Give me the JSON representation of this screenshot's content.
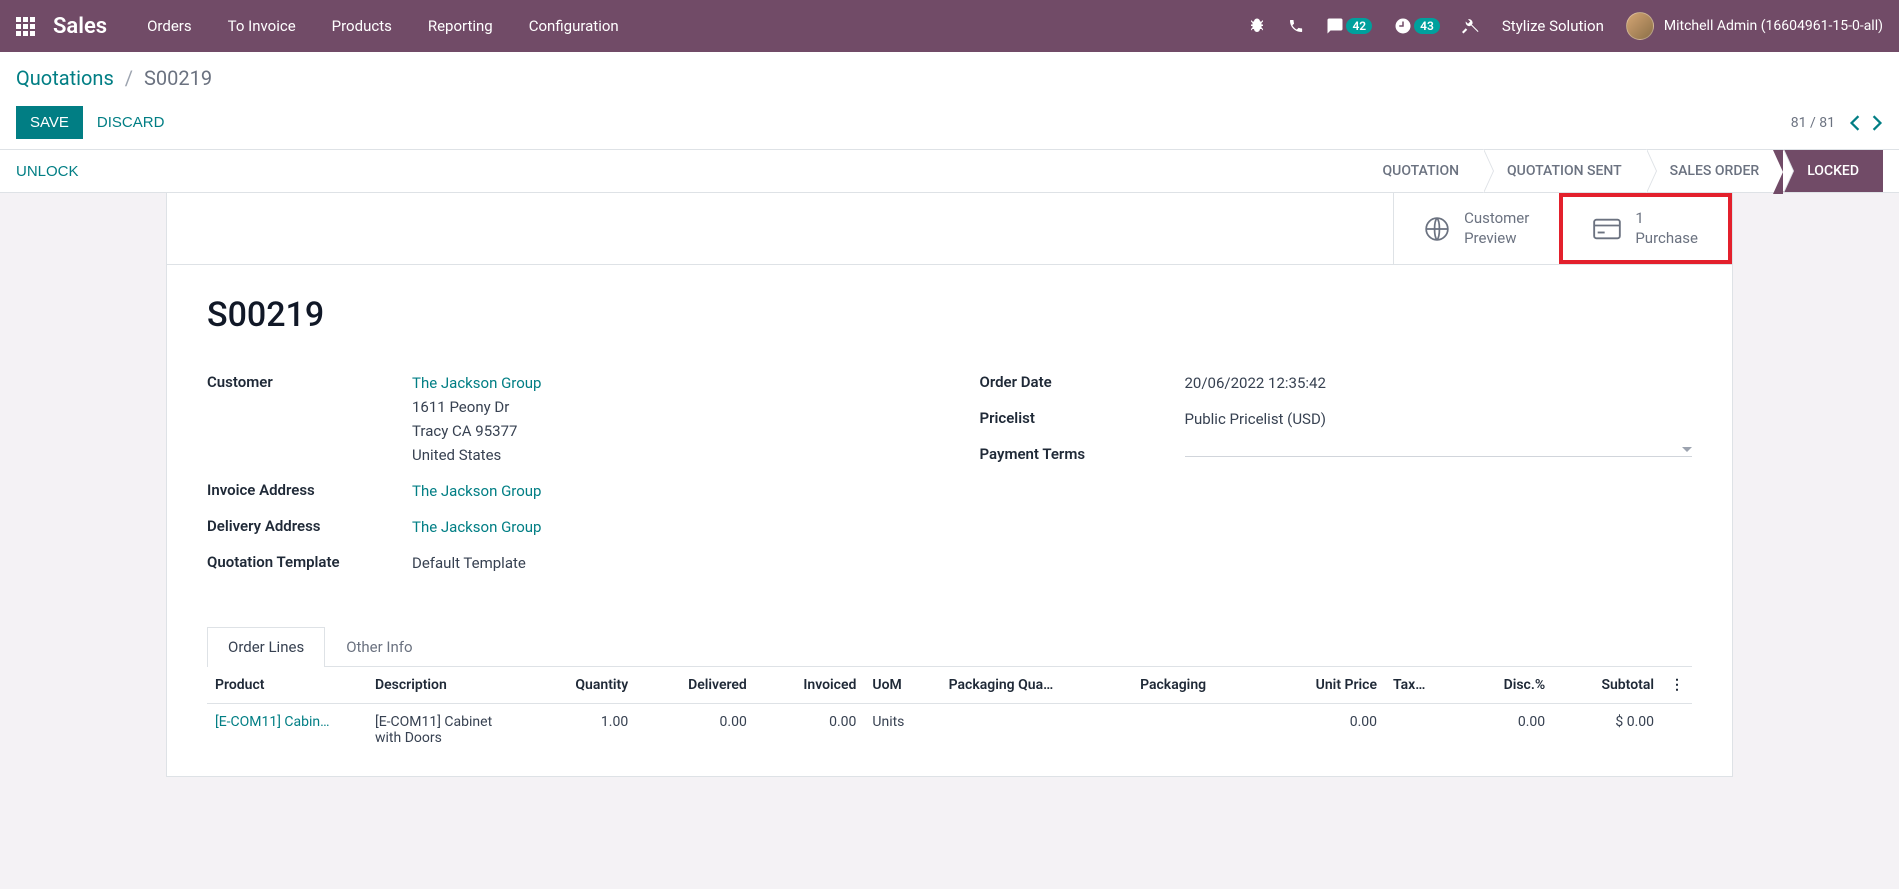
{
  "topnav": {
    "brand": "Sales",
    "menu": [
      "Orders",
      "To Invoice",
      "Products",
      "Reporting",
      "Configuration"
    ],
    "badges": {
      "messages": "42",
      "activities": "43"
    },
    "company": "Stylize Solution",
    "user": "Mitchell Admin (16604961-15-0-all)"
  },
  "breadcrumb": {
    "root": "Quotations",
    "current": "S00219"
  },
  "actions": {
    "save": "SAVE",
    "discard": "DISCARD",
    "unlock": "UNLOCK"
  },
  "pager": {
    "text": "81 / 81"
  },
  "status": {
    "steps": [
      "QUOTATION",
      "QUOTATION SENT",
      "SALES ORDER",
      "LOCKED"
    ],
    "active": 3
  },
  "stat_buttons": {
    "preview": {
      "line1": "Customer",
      "line2": "Preview"
    },
    "purchase": {
      "line1": "1",
      "line2": "Purchase"
    }
  },
  "record": {
    "title": "S00219",
    "left": {
      "customer_label": "Customer",
      "customer_link": "The Jackson Group",
      "customer_addr1": "1611 Peony Dr",
      "customer_addr2": "Tracy CA 95377",
      "customer_addr3": "United States",
      "invoice_label": "Invoice Address",
      "invoice_value": "The Jackson Group",
      "delivery_label": "Delivery Address",
      "delivery_value": "The Jackson Group",
      "template_label": "Quotation Template",
      "template_value": "Default Template"
    },
    "right": {
      "orderdate_label": "Order Date",
      "orderdate_value": "20/06/2022 12:35:42",
      "pricelist_label": "Pricelist",
      "pricelist_value": "Public Pricelist (USD)",
      "terms_label": "Payment Terms",
      "terms_value": ""
    }
  },
  "tabs": {
    "order_lines": "Order Lines",
    "other_info": "Other Info"
  },
  "table": {
    "headers": {
      "product": "Product",
      "description": "Description",
      "quantity": "Quantity",
      "delivered": "Delivered",
      "invoiced": "Invoiced",
      "uom": "UoM",
      "pkg_qty": "Packaging Qua…",
      "pkg": "Packaging",
      "unit_price": "Unit Price",
      "tax": "Tax…",
      "disc": "Disc.%",
      "subtotal": "Subtotal"
    },
    "rows": [
      {
        "product": "[E-COM11] Cabin…",
        "description": "[E-COM11] Cabinet with Doors",
        "quantity": "1.00",
        "delivered": "0.00",
        "invoiced": "0.00",
        "uom": "Units",
        "pkg_qty": "",
        "pkg": "",
        "unit_price": "0.00",
        "tax": "",
        "disc": "0.00",
        "subtotal": "$ 0.00"
      }
    ]
  }
}
